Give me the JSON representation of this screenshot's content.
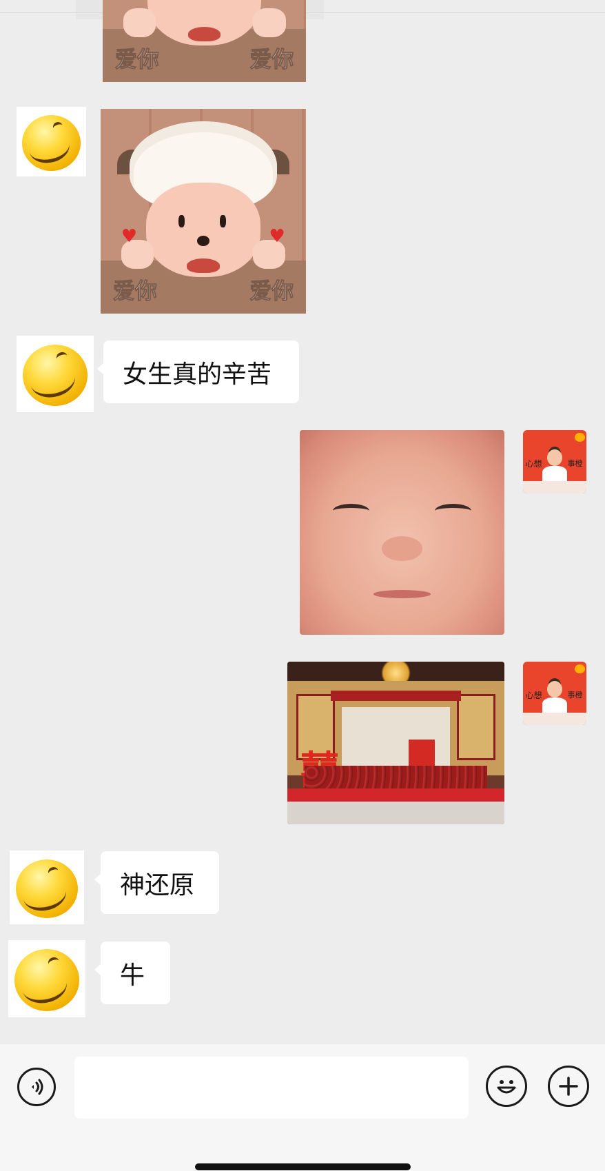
{
  "messages": {
    "sticker_caption_left": "爱你",
    "sticker_caption_right": "爱你",
    "msg1_text": "女生真的辛苦",
    "msg2_text": "神还原",
    "msg3_text": "牛"
  },
  "photos": {
    "venue_char": "囍"
  },
  "avatar_right_text": {
    "left": "心想",
    "right": "事橙"
  },
  "icons": {
    "voice": "voice-icon",
    "emoji": "emoji-icon",
    "plus": "plus-icon"
  },
  "colors": {
    "chat_bg": "#ededed",
    "bubble_bg": "#ffffff",
    "input_bar_bg": "#f6f6f6"
  }
}
